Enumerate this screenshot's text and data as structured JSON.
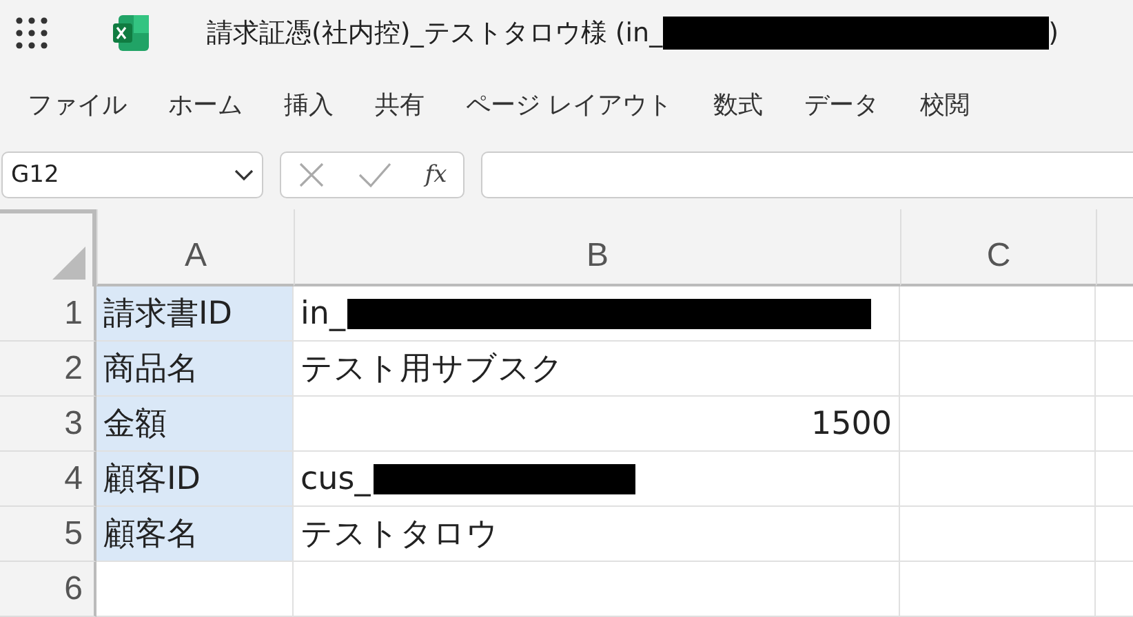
{
  "window": {
    "title": "請求証憑(社内控)_テストタロウ様 (in_",
    "title_redacted": true,
    "title_end": ")"
  },
  "menu": [
    {
      "label": "ファイル"
    },
    {
      "label": "ホーム"
    },
    {
      "label": "挿入"
    },
    {
      "label": "共有"
    },
    {
      "label": "ページ レイアウト"
    },
    {
      "label": "数式"
    },
    {
      "label": "データ"
    },
    {
      "label": "校閲"
    }
  ],
  "name_box": {
    "value": "G12"
  },
  "formula_bar": {
    "fx": "fx"
  },
  "columns": [
    "A",
    "B",
    "C"
  ],
  "rows": [
    {
      "number": "1",
      "cells": [
        {
          "text": "請求書ID",
          "kind": "text",
          "highlighted": true
        },
        {
          "text": "in_",
          "kind": "text",
          "highlighted": false,
          "redacted": true
        },
        {
          "text": "",
          "kind": "empty",
          "highlighted": false
        }
      ]
    },
    {
      "number": "2",
      "cells": [
        {
          "text": "商品名",
          "kind": "text",
          "highlighted": true
        },
        {
          "text": "テスト用サブスク",
          "kind": "text",
          "highlighted": false,
          "redacted": false
        },
        {
          "text": "",
          "kind": "empty",
          "highlighted": false
        }
      ]
    },
    {
      "number": "3",
      "cells": [
        {
          "text": "金額",
          "kind": "text",
          "highlighted": true
        },
        {
          "text": "1500",
          "kind": "number",
          "highlighted": false,
          "redacted": false
        },
        {
          "text": "",
          "kind": "empty",
          "highlighted": false
        }
      ]
    },
    {
      "number": "4",
      "cells": [
        {
          "text": "顧客ID",
          "kind": "text",
          "highlighted": true
        },
        {
          "text": "cus_",
          "kind": "text",
          "highlighted": false,
          "redacted": true
        },
        {
          "text": "",
          "kind": "empty",
          "highlighted": false
        }
      ]
    },
    {
      "number": "5",
      "cells": [
        {
          "text": "顧客名",
          "kind": "text",
          "highlighted": true
        },
        {
          "text": "テストタロウ",
          "kind": "text",
          "highlighted": false,
          "redacted": false
        },
        {
          "text": "",
          "kind": "empty",
          "highlighted": false
        }
      ]
    },
    {
      "number": "6",
      "cells": [
        {
          "text": "",
          "kind": "empty",
          "highlighted": false
        },
        {
          "text": "",
          "kind": "empty",
          "highlighted": false
        },
        {
          "text": "",
          "kind": "empty",
          "highlighted": false
        }
      ]
    }
  ]
}
